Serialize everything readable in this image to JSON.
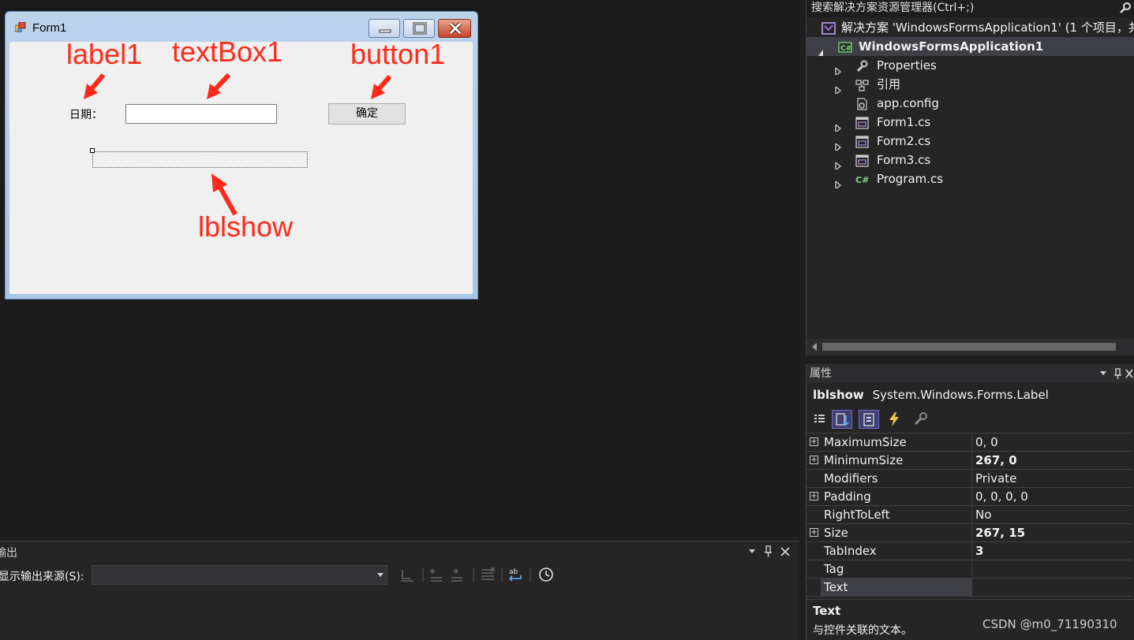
{
  "form": {
    "title": "Form1",
    "label1_text": "日期：",
    "button1_text": "确定"
  },
  "annotations": {
    "label1": "label1",
    "textbox1": "textBox1",
    "button1": "button1",
    "lblshow": "lblshow",
    "color": "#ff2a1a"
  },
  "solution_explorer": {
    "search_label": "搜索解决方案资源管理器(Ctrl+;)",
    "solution_label": "解决方案 'WindowsFormsApplication1' (1 个项目，共",
    "project_label": "WindowsFormsApplication1",
    "items": [
      {
        "label": "Properties",
        "icon": "wrench-icon",
        "expandable": true
      },
      {
        "label": "引用",
        "icon": "references-icon",
        "expandable": true
      },
      {
        "label": "app.config",
        "icon": "config-file-icon",
        "expandable": false
      },
      {
        "label": "Form1.cs",
        "icon": "form-file-icon",
        "expandable": true
      },
      {
        "label": "Form2.cs",
        "icon": "form-file-icon",
        "expandable": true
      },
      {
        "label": "Form3.cs",
        "icon": "form-file-icon",
        "expandable": true
      },
      {
        "label": "Program.cs",
        "icon": "csharp-file-icon",
        "expandable": true
      }
    ]
  },
  "properties": {
    "title": "属性",
    "object_name": "lblshow",
    "object_type": "System.Windows.Forms.Label",
    "rows": [
      {
        "name": "MaximumSize",
        "value": "0, 0",
        "expandable": true,
        "bold": false
      },
      {
        "name": "MinimumSize",
        "value": "267, 0",
        "expandable": true,
        "bold": true
      },
      {
        "name": "Modifiers",
        "value": "Private",
        "expandable": false,
        "bold": false
      },
      {
        "name": "Padding",
        "value": "0, 0, 0, 0",
        "expandable": true,
        "bold": false
      },
      {
        "name": "RightToLeft",
        "value": "No",
        "expandable": false,
        "bold": false
      },
      {
        "name": "Size",
        "value": "267, 15",
        "expandable": true,
        "bold": true
      },
      {
        "name": "TabIndex",
        "value": "3",
        "expandable": false,
        "bold": true
      },
      {
        "name": "Tag",
        "value": "",
        "expandable": false,
        "bold": false
      },
      {
        "name": "Text",
        "value": "",
        "expandable": false,
        "bold": false,
        "selected": true
      }
    ],
    "description_title": "Text",
    "description_text": "与控件关联的文本。"
  },
  "output": {
    "title": "输出",
    "source_label": "显示输出来源(S):",
    "source_value": ""
  },
  "watermark": "CSDN @m0_71190310",
  "colors": {
    "background": "#1e1e1e",
    "panel": "#252526",
    "selection": "#3f3f46",
    "form_client": "#f0f0f0"
  }
}
